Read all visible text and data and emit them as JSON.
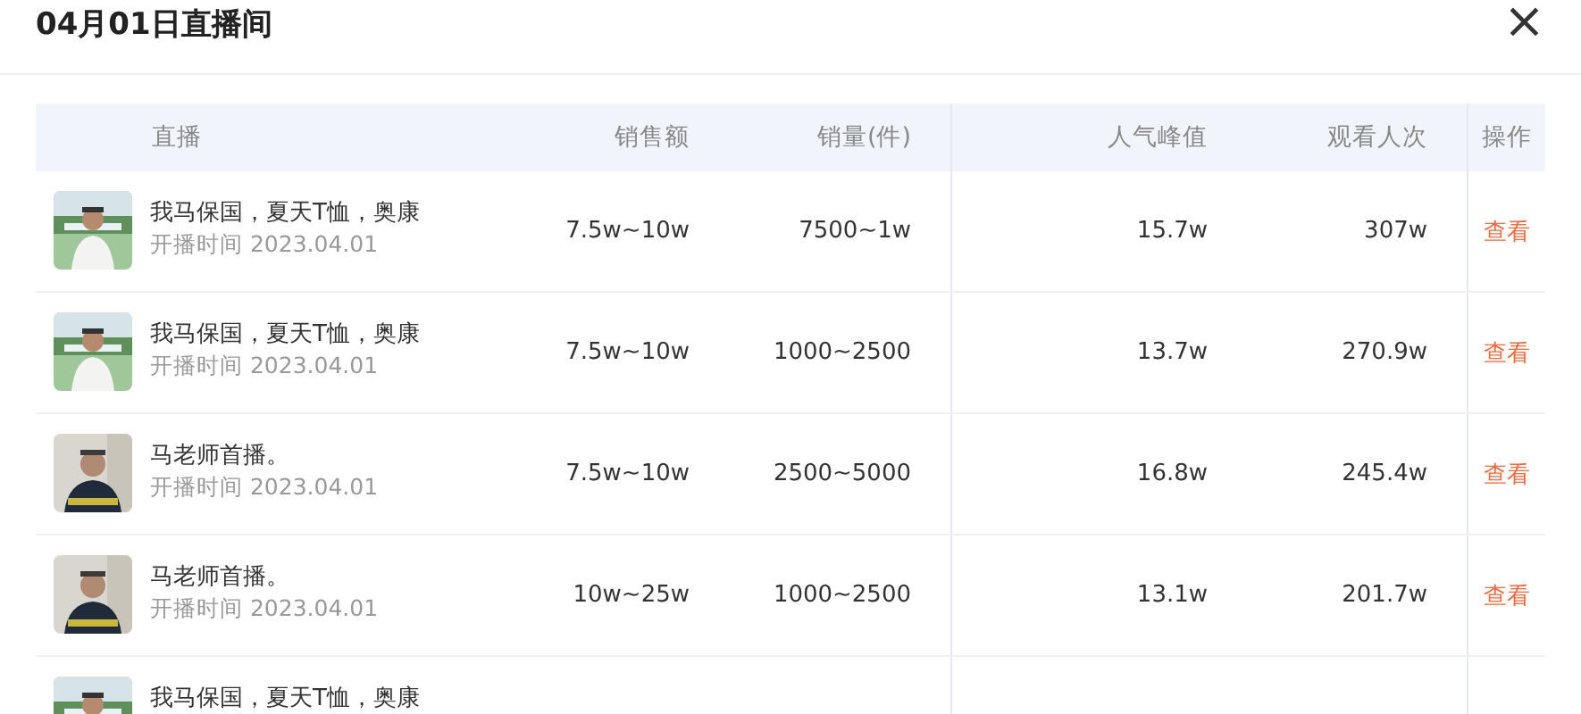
{
  "dialog": {
    "title": "04月01日直播间",
    "close": "×"
  },
  "table": {
    "columns": [
      "直播",
      "销售额",
      "销量(件)",
      "人气峰值",
      "观看人次",
      "操作"
    ],
    "rows": [
      {
        "title": "我马保国，夏天T恤，奥康",
        "start_time": "开播时间 2023.04.01",
        "sales_amount": "7.5w~10w",
        "sales_volume": "7500~1w",
        "peak_popularity": "15.7w",
        "views": "307w",
        "action": "查看"
      },
      {
        "title": "我马保国，夏天T恤，奥康",
        "start_time": "开播时间 2023.04.01",
        "sales_amount": "7.5w~10w",
        "sales_volume": "1000~2500",
        "peak_popularity": "13.7w",
        "views": "270.9w",
        "action": "查看"
      },
      {
        "title": "马老师首播。",
        "start_time": "开播时间 2023.04.01",
        "sales_amount": "7.5w~10w",
        "sales_volume": "2500~5000",
        "peak_popularity": "16.8w",
        "views": "245.4w",
        "action": "查看"
      },
      {
        "title": "马老师首播。",
        "start_time": "开播时间 2023.04.01",
        "sales_amount": "10w~25w",
        "sales_volume": "1000~2500",
        "peak_popularity": "13.1w",
        "views": "201.7w",
        "action": "查看"
      },
      {
        "title": "我马保国，夏天T恤，奥康"
      }
    ]
  }
}
